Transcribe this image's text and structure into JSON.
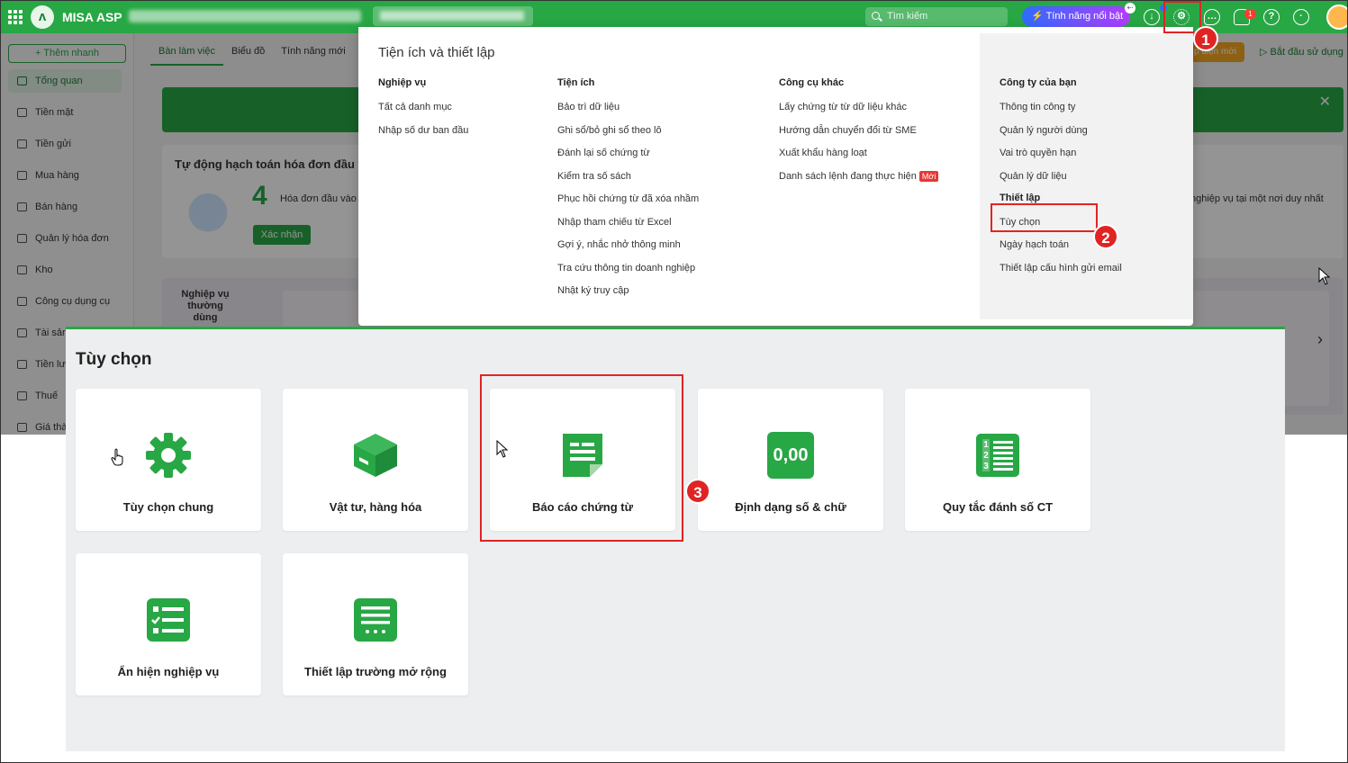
{
  "topbar": {
    "app_name": "MISA ASP",
    "search_placeholder": "Tìm kiếm",
    "feature_label": "Tính năng nổi bật",
    "notification_count": "1"
  },
  "sidebar": {
    "quick_add": "+ Thêm nhanh",
    "items": [
      {
        "label": "Tổng quan"
      },
      {
        "label": "Tiền mặt"
      },
      {
        "label": "Tiền gửi"
      },
      {
        "label": "Mua hàng"
      },
      {
        "label": "Bán hàng"
      },
      {
        "label": "Quản lý hóa đơn"
      },
      {
        "label": "Kho"
      },
      {
        "label": "Công cụ dụng cụ"
      },
      {
        "label": "Tài sản"
      },
      {
        "label": "Tiền lư"
      },
      {
        "label": "Thuế"
      },
      {
        "label": "Giá thà"
      }
    ]
  },
  "background": {
    "tabs": [
      "Bàn làm việc",
      "Biểu đồ",
      "Tính năng mới"
    ],
    "card_title": "Tự động hạch toán hóa đơn đầu v",
    "count": "4",
    "count_label": "Hóa đơn đầu vào",
    "confirm_label": "Xác nhận",
    "right_text": "nghiệp vụ tại một nơi duy nhất",
    "usual_label": "Nghiệp vụ thường dùng",
    "start_label": "Bắt đầu sử dụng",
    "orange_label": "p diện mới"
  },
  "dropdown": {
    "title": "Tiện ích và thiết lập",
    "col1": {
      "heading": "Nghiệp vụ",
      "items": [
        "Tất cả danh mục",
        "Nhập số dư ban đầu"
      ]
    },
    "col2": {
      "heading": "Tiện ích",
      "items": [
        "Bảo trì dữ liệu",
        "Ghi sổ/bỏ ghi sổ theo lô",
        "Đánh lại số chứng từ",
        "Kiểm tra số sách",
        "Phục hồi chứng từ đã xóa nhầm",
        "Nhập tham chiếu từ Excel",
        "Gợi ý, nhắc nhở thông minh",
        "Tra cứu thông tin doanh nghiệp",
        "Nhật ký truy cập"
      ]
    },
    "col3": {
      "heading": "Công cụ khác",
      "items": [
        "Lấy chứng từ từ dữ liệu khác",
        "Hướng dẫn chuyển đổi từ SME",
        "Xuất khẩu hàng loạt",
        "Danh sách lệnh đang thực hiện"
      ],
      "new_badge": "Mới"
    },
    "col4": {
      "heading": "Công ty của bạn",
      "items": [
        "Thông tin công ty",
        "Quản lý người dùng",
        "Vai trò quyền hạn",
        "Quản lý dữ liệu"
      ],
      "sub_heading": "Thiết lập",
      "sub_items": [
        "Tùy chọn",
        "Ngày hạch toán",
        "Thiết lập cấu hình gửi email"
      ]
    }
  },
  "options": {
    "title": "Tùy chọn",
    "cards": [
      {
        "label": "Tùy chọn chung",
        "icon": "gear-icon"
      },
      {
        "label": "Vật tư, hàng hóa",
        "icon": "box-icon"
      },
      {
        "label": "Báo cáo chứng từ",
        "icon": "document-icon"
      },
      {
        "label": "Định dạng số & chữ",
        "icon": "number-format-icon",
        "icon_text": "0,00"
      },
      {
        "label": "Quy tắc đánh số CT",
        "icon": "numbered-list-icon",
        "icon_text": "123"
      },
      {
        "label": "Ẩn hiện nghiệp vụ",
        "icon": "checklist-icon"
      },
      {
        "label": "Thiết lập trường mở rộng",
        "icon": "form-icon"
      }
    ]
  },
  "annotations": [
    "1",
    "2",
    "3"
  ],
  "colors": {
    "brand": "#28a745",
    "annotation": "#e02424"
  }
}
